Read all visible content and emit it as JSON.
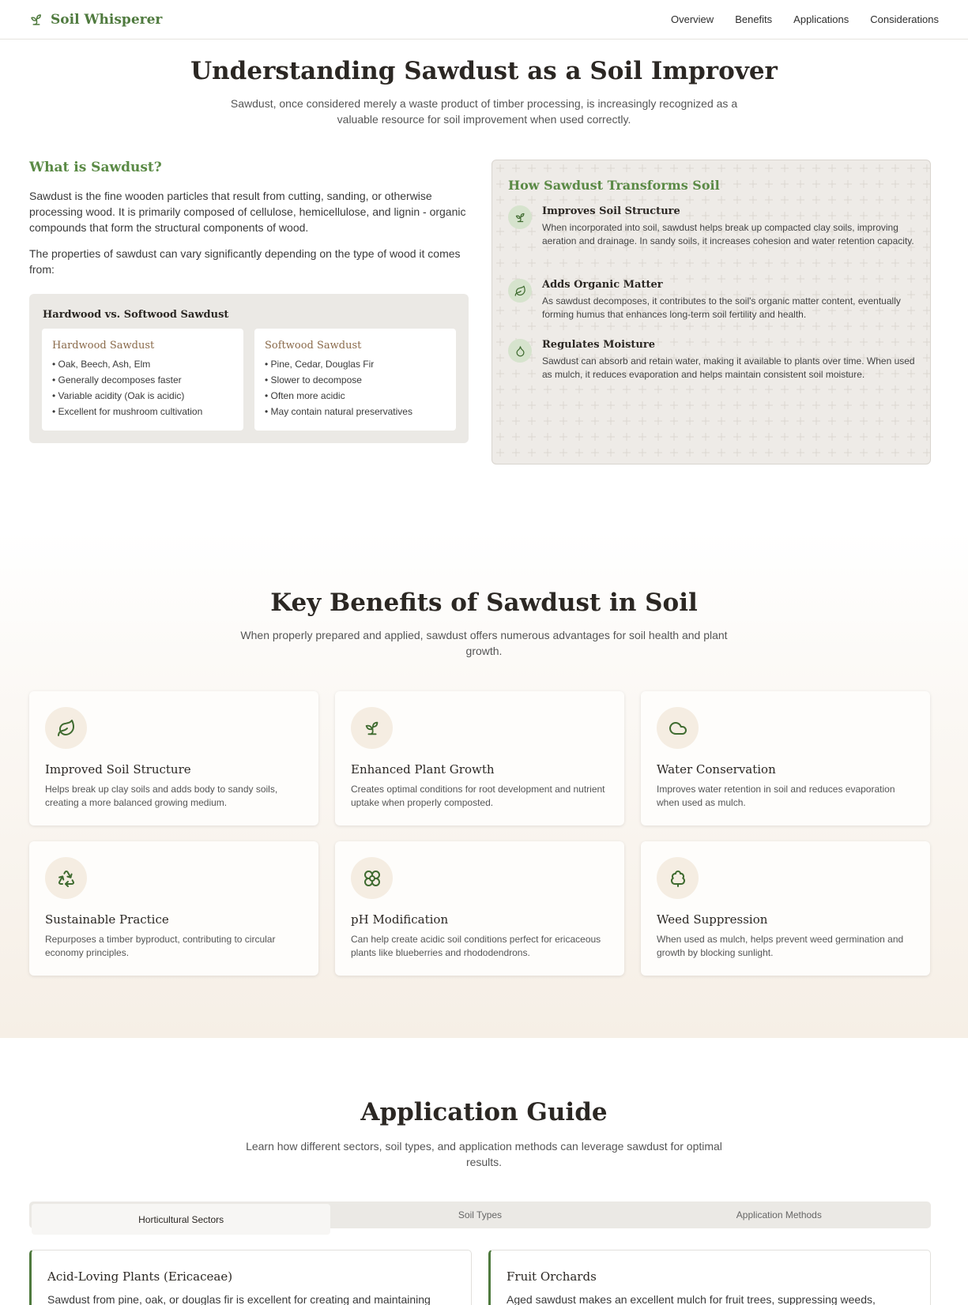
{
  "nav": {
    "brand": "Soil Whisperer",
    "brand_icon": "sprout-icon",
    "links": [
      "Overview",
      "Benefits",
      "Applications",
      "Considerations"
    ]
  },
  "hero": {
    "title": "Understanding Sawdust as a Soil Improver",
    "subtitle": "Sawdust, once considered merely a waste product of timber processing, is increasingly recognized as a valuable resource for soil improvement when used correctly."
  },
  "what": {
    "heading": "What is Sawdust?",
    "p1": "Sawdust is the fine wooden particles that result from cutting, sanding, or otherwise processing wood. It is primarily composed of cellulose, hemicellulose, and lignin - organic compounds that form the structural components of wood.",
    "p2": "The properties of sawdust can vary significantly depending on the type of wood it comes from:",
    "compare": {
      "heading": "Hardwood vs. Softwood Sawdust",
      "hardwood": {
        "title": "Hardwood Sawdust",
        "items": [
          "• Oak, Beech, Ash, Elm",
          "• Generally decomposes faster",
          "• Variable acidity (Oak is acidic)",
          "• Excellent for mushroom cultivation"
        ]
      },
      "softwood": {
        "title": "Softwood Sawdust",
        "items": [
          "• Pine, Cedar, Douglas Fir",
          "• Slower to decompose",
          "• Often more acidic",
          "• May contain natural preservatives"
        ]
      }
    }
  },
  "transform": {
    "heading": "How Sawdust Transforms Soil",
    "items": [
      {
        "title": "Improves Soil Structure",
        "desc": "When incorporated into soil, sawdust helps break up compacted clay soils, improving aeration and drainage. In sandy soils, it increases cohesion and water retention capacity.",
        "icon": "sprout-icon"
      },
      {
        "title": "Adds Organic Matter",
        "desc": "As sawdust decomposes, it contributes to the soil's organic matter content, eventually forming humus that enhances long-term soil fertility and health.",
        "icon": "leaf-icon"
      },
      {
        "title": "Regulates Moisture",
        "desc": "Sawdust can absorb and retain water, making it available to plants over time. When used as mulch, it reduces evaporation and helps maintain consistent soil moisture.",
        "icon": "droplet-icon"
      }
    ]
  },
  "benefits": {
    "title": "Key Benefits of Sawdust in Soil",
    "subtitle": "When properly prepared and applied, sawdust offers numerous advantages for soil health and plant growth.",
    "cards": [
      {
        "title": "Improved Soil Structure",
        "desc": "Helps break up clay soils and adds body to sandy soils, creating a more balanced growing medium.",
        "icon": "leaf-icon"
      },
      {
        "title": "Enhanced Plant Growth",
        "desc": "Creates optimal conditions for root development and nutrient uptake when properly composted.",
        "icon": "sprout-icon"
      },
      {
        "title": "Water Conservation",
        "desc": "Improves water retention in soil and reduces evaporation when used as mulch.",
        "icon": "cloud-icon"
      },
      {
        "title": "Sustainable Practice",
        "desc": "Repurposes a timber byproduct, contributing to circular economy principles.",
        "icon": "recycle-icon"
      },
      {
        "title": "pH Modification",
        "desc": "Can help create acidic soil conditions perfect for ericaceous plants like blueberries and rhododendrons.",
        "icon": "flower-icon"
      },
      {
        "title": "Weed Suppression",
        "desc": "When used as mulch, helps prevent weed germination and growth by blocking sunlight.",
        "icon": "tree-icon"
      }
    ]
  },
  "guide": {
    "title": "Application Guide",
    "subtitle": "Learn how different sectors, soil types, and application methods can leverage sawdust for optimal results.",
    "tabs": [
      "Horticultural Sectors",
      "Soil Types",
      "Application Methods"
    ],
    "active_tab": "Horticultural Sectors",
    "cards": [
      {
        "title": "Acid-Loving Plants (Ericaceae)",
        "desc": "Sawdust from pine, oak, or douglas fir is excellent for creating and maintaining"
      },
      {
        "title": "Fruit Orchards",
        "desc": "Aged sawdust makes an excellent mulch for fruit trees, suppressing weeds,"
      }
    ]
  },
  "colors": {
    "brand_green": "#4f7a3e",
    "heading_green": "#5a8a45",
    "icon_circle_green": "#d6e3cd",
    "icon_circle_beige": "#f5ede2"
  }
}
